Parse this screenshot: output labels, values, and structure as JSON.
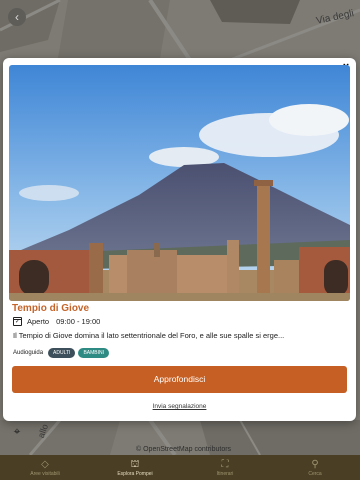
{
  "map": {
    "street_label_top": "Via degli",
    "street_label_bottom": "allo",
    "attribution": "© OpenStreetMap contributors"
  },
  "bottom_nav": {
    "items": [
      {
        "label": "Aree visitabili",
        "icon": "route-icon",
        "active": false
      },
      {
        "label": "Esplora Pompei",
        "icon": "temple-icon",
        "active": true
      },
      {
        "label": "Itinerari",
        "icon": "map-icon",
        "active": false
      },
      {
        "label": "Cerca",
        "icon": "search-icon",
        "active": false
      }
    ]
  },
  "poi": {
    "close_label": "×",
    "title": "Tempio di Giove",
    "status": "Aperto",
    "hours": "09:00 - 19:00",
    "description": "Il Tempio di Giove domina il lato settentrionale del Foro, e alle sue spalle si erge...",
    "audio_label": "Audioguida",
    "tags": [
      "ADULTI",
      "BAMBINI"
    ],
    "primary_button": "Approfondisci",
    "report_link": "Invia segnalazione"
  },
  "colors": {
    "accent": "#c65f24",
    "title": "#c4642a",
    "tag_adulti": "#3d4f5a",
    "tag_bambini": "#2e8b84",
    "nav_bar": "#4a3e24"
  }
}
